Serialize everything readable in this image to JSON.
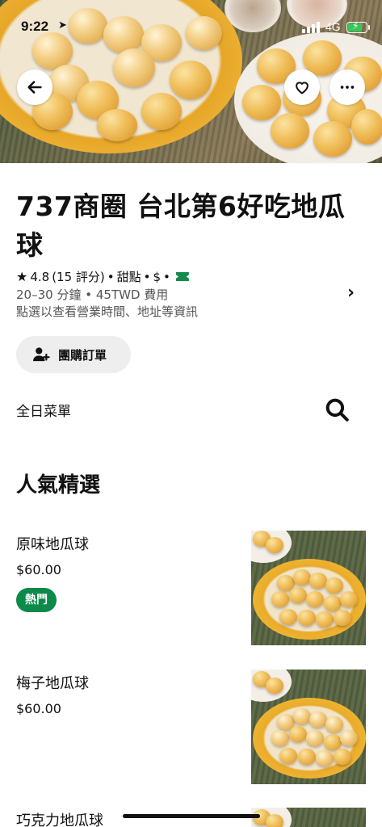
{
  "status": {
    "time": "9:22",
    "network": "4G"
  },
  "store": {
    "name": "737商圈 台北第6好吃地瓜球",
    "rating": "4.8",
    "reviews": "(15 評分)",
    "category": "甜點",
    "price_level": "$",
    "delivery_time": "20–30 分鐘",
    "delivery_fee": "45TWD 費用",
    "info_hint": "點選以查看營業時間、地址等資訊"
  },
  "actions": {
    "group_order": "團購訂單",
    "menu_name": "全日菜單"
  },
  "section": {
    "title": "人氣精選"
  },
  "items": [
    {
      "name": "原味地瓜球",
      "price": "$60.00",
      "badge": "熱門"
    },
    {
      "name": "梅子地瓜球",
      "price": "$60.00"
    },
    {
      "name": "巧克力地瓜球"
    }
  ],
  "icons": {
    "back": "arrow-left-icon",
    "favorite": "heart-icon",
    "more": "more-icon",
    "search": "search-icon",
    "group": "add-person-icon",
    "chevron": "chevron-right-icon",
    "star": "star-icon",
    "ticket": "ticket-icon"
  },
  "colors": {
    "accent_green": "#0d8a4a",
    "text": "#111111",
    "muted": "#555555"
  }
}
